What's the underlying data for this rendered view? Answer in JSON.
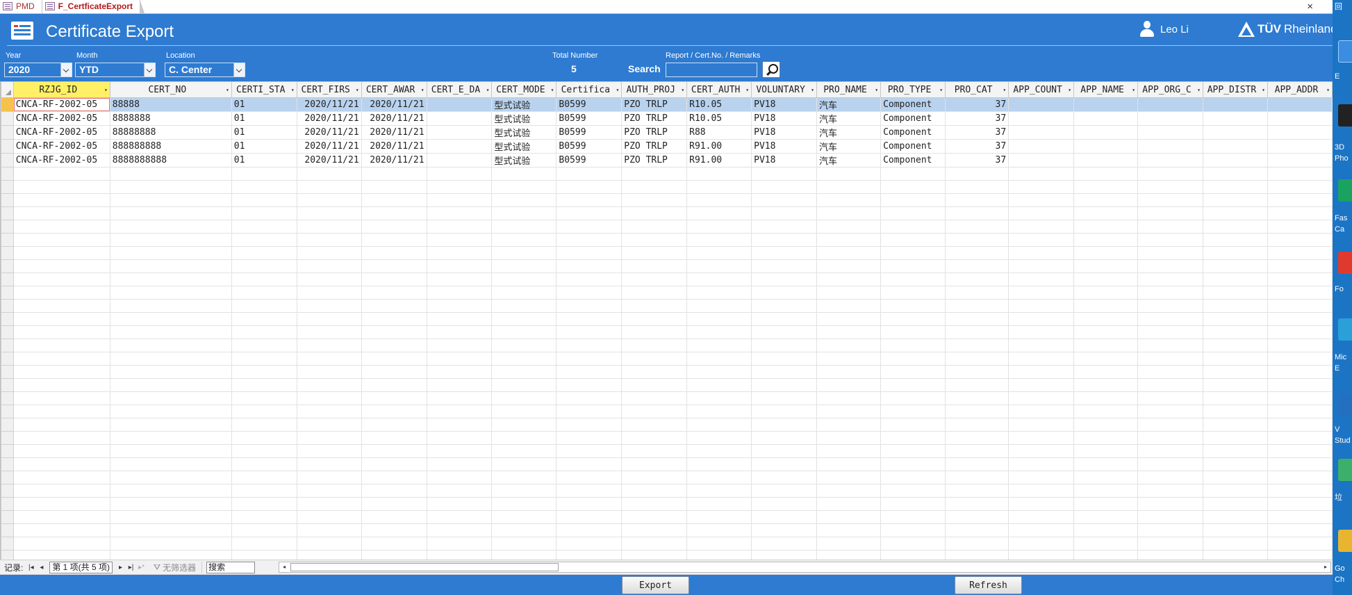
{
  "tabs": [
    {
      "label": "PMD",
      "active": false
    },
    {
      "label": "F_CertficateExport",
      "active": true
    }
  ],
  "window": {
    "close_glyph": "×"
  },
  "header": {
    "title": "Certificate Export",
    "user_name": "Leo Li",
    "brand_tuv": "TÜV",
    "brand_rheinland": "Rheinland"
  },
  "filters": {
    "year_label": "Year",
    "year_value": "2020",
    "month_label": "Month",
    "month_value": "YTD",
    "location_label": "Location",
    "location_value": "C. Center",
    "total_label": "Total Number",
    "total_value": "5",
    "search_label": "Search",
    "remarks_label": "Report / Cert.No. / Remarks",
    "search_value": ""
  },
  "table": {
    "columns": [
      "RZJG_ID",
      "CERT_NO",
      "CERTI_STA",
      "CERT_FIRS",
      "CERT_AWAR",
      "CERT_E_DA",
      "CERT_MODE",
      "Certifica",
      "AUTH_PROJ",
      "CERT_AUTH",
      "VOLUNTARY",
      "PRO_NAME",
      "PRO_TYPE",
      "PRO_CAT",
      "APP_COUNT",
      "APP_NAME",
      "APP_ORG_C",
      "APP_DISTR",
      "APP_ADDR"
    ],
    "rows": [
      [
        "CNCA-RF-2002-05",
        "88888",
        "01",
        "2020/11/21",
        "2020/11/21",
        "",
        "型式试验",
        "B0599",
        "PZO TRLP",
        "R10.05",
        "PV18",
        "汽车",
        "Component",
        "37",
        "",
        "",
        "",
        "",
        ""
      ],
      [
        "CNCA-RF-2002-05",
        "8888888",
        "01",
        "2020/11/21",
        "2020/11/21",
        "",
        "型式试验",
        "B0599",
        "PZO TRLP",
        "R10.05",
        "PV18",
        "汽车",
        "Component",
        "37",
        "",
        "",
        "",
        "",
        ""
      ],
      [
        "CNCA-RF-2002-05",
        "88888888",
        "01",
        "2020/11/21",
        "2020/11/21",
        "",
        "型式试验",
        "B0599",
        "PZO TRLP",
        "R88",
        "PV18",
        "汽车",
        "Component",
        "37",
        "",
        "",
        "",
        "",
        ""
      ],
      [
        "CNCA-RF-2002-05",
        "888888888",
        "01",
        "2020/11/21",
        "2020/11/21",
        "",
        "型式试验",
        "B0599",
        "PZO TRLP",
        "R91.00",
        "PV18",
        "汽车",
        "Component",
        "37",
        "",
        "",
        "",
        "",
        ""
      ],
      [
        "CNCA-RF-2002-05",
        "8888888888",
        "01",
        "2020/11/21",
        "2020/11/21",
        "",
        "型式试验",
        "B0599",
        "PZO TRLP",
        "R91.00",
        "PV18",
        "汽车",
        "Component",
        "37",
        "",
        "",
        "",
        "",
        ""
      ]
    ]
  },
  "navbar": {
    "record_label": "记录:",
    "first": "|◂",
    "prev": "◂",
    "position": "第 1 项(共 5 项)",
    "next": "▸",
    "last": "▸|",
    "new": "▸*",
    "filter_label": "无筛选器",
    "search_value": "搜索"
  },
  "footer": {
    "export_label": "Export",
    "refresh_label": "Refresh"
  },
  "desktop": {
    "labels": [
      "回",
      "E",
      "3D",
      "Pho",
      "Fas",
      "Ca",
      "Fo",
      "Mic",
      "E",
      "V",
      "Stud",
      "垃",
      "Go",
      "Ch"
    ]
  },
  "colors": {
    "header_blue": "#2e7bd1",
    "selected_row": "#b9d3ef",
    "selected_header": "#fff066",
    "accent_red": "#b01818"
  }
}
